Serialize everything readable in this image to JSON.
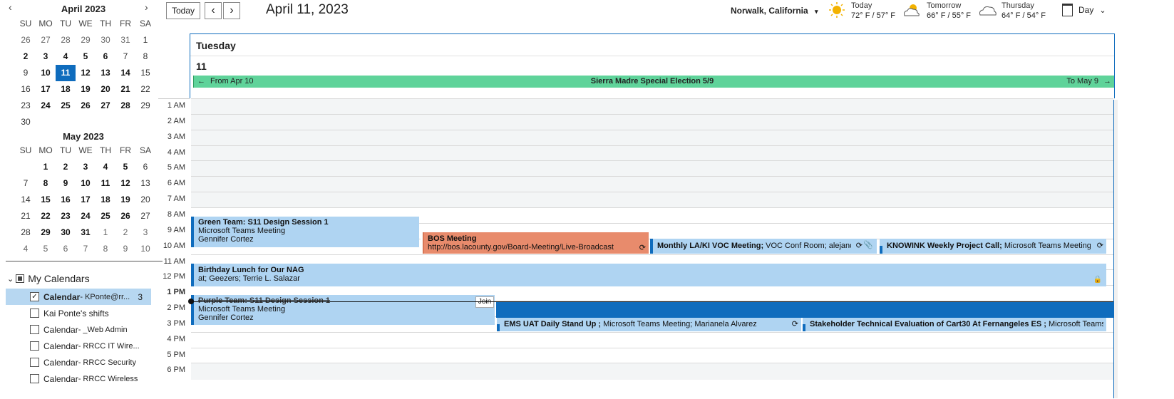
{
  "mini_calendars": [
    {
      "title": "April 2023",
      "dows": [
        "SU",
        "MO",
        "TU",
        "WE",
        "TH",
        "FR",
        "SA"
      ],
      "weeks": [
        [
          "26",
          "27",
          "28",
          "29",
          "30",
          "31",
          "1"
        ],
        [
          "2",
          "3",
          "4",
          "5",
          "6",
          "7",
          "8"
        ],
        [
          "9",
          "10",
          "11",
          "12",
          "13",
          "14",
          "15"
        ],
        [
          "16",
          "17",
          "18",
          "19",
          "20",
          "21",
          "22"
        ],
        [
          "23",
          "24",
          "25",
          "26",
          "27",
          "28",
          "29"
        ],
        [
          "30",
          "",
          "",
          "",
          "",
          "",
          ""
        ]
      ]
    },
    {
      "title": "May 2023",
      "dows": [
        "SU",
        "MO",
        "TU",
        "WE",
        "TH",
        "FR",
        "SA"
      ],
      "weeks": [
        [
          "",
          "1",
          "2",
          "3",
          "4",
          "5",
          "6"
        ],
        [
          "7",
          "8",
          "9",
          "10",
          "11",
          "12",
          "13"
        ],
        [
          "14",
          "15",
          "16",
          "17",
          "18",
          "19",
          "20"
        ],
        [
          "21",
          "22",
          "23",
          "24",
          "25",
          "26",
          "27"
        ],
        [
          "28",
          "29",
          "30",
          "31",
          "1",
          "2",
          "3"
        ],
        [
          "4",
          "5",
          "6",
          "7",
          "8",
          "9",
          "10"
        ]
      ]
    }
  ],
  "nav": {
    "prev": "‹",
    "next": "›"
  },
  "my_calendars": {
    "header": "My Calendars",
    "items": [
      {
        "label": "Calendar",
        "detail": " - KPonte@rr...",
        "count": "3",
        "checked": true,
        "selected": true
      },
      {
        "label": "Kai Ponte's shifts",
        "detail": "",
        "count": "",
        "checked": false,
        "selected": false
      },
      {
        "label": "Calendar",
        "detail": " - _Web Admin",
        "count": "",
        "checked": false,
        "selected": false
      },
      {
        "label": "Calendar",
        "detail": " - RRCC IT Wire...",
        "count": "",
        "checked": false,
        "selected": false
      },
      {
        "label": "Calendar",
        "detail": " - RRCC Security",
        "count": "",
        "checked": false,
        "selected": false
      },
      {
        "label": "Calendar",
        "detail": " - RRCC Wireless",
        "count": "",
        "checked": false,
        "selected": false
      }
    ]
  },
  "toolbar": {
    "today_label": "Today",
    "prev_label": "‹",
    "next_label": "›",
    "date_title": "April 11, 2023",
    "location": "Norwalk, California",
    "view_label": "Day"
  },
  "weather": [
    {
      "label": "Today",
      "temps": "72° F / 57° F",
      "icon": "sun-icon"
    },
    {
      "label": "Tomorrow",
      "temps": "66° F / 55° F",
      "icon": "partly-cloudy-icon"
    },
    {
      "label": "Thursday",
      "temps": "64° F / 54° F",
      "icon": "cloud-icon"
    }
  ],
  "day": {
    "name": "Tuesday",
    "number": "11",
    "allday_banner": {
      "left": "From Apr 10",
      "title": "Sierra Madre Special Election 5/9",
      "right": "To May 9",
      "color": "#5fd39a"
    }
  },
  "hours": [
    "1 AM",
    "2 AM",
    "3 AM",
    "4 AM",
    "5 AM",
    "6 AM",
    "7 AM",
    "8 AM",
    "9 AM",
    "10 AM",
    "11 AM",
    "12 PM",
    "1 PM",
    "2 PM",
    "3 PM",
    "4 PM",
    "5 PM",
    "6 PM"
  ],
  "events": {
    "green_team": {
      "title": "Green Team: S11 Design Session 1",
      "line2": "Microsoft Teams Meeting",
      "line3": "Gennifer Cortez"
    },
    "bos": {
      "title": "BOS Meeting",
      "line2": "http://bos.lacounty.gov/Board-Meeting/Live-Broadcast"
    },
    "monthly": {
      "title": "Monthly LA/KI VOC Meeting;",
      "rest": " VOC Conf Room; alejandra"
    },
    "knowink": {
      "title": "KNOWINK Weekly Project Call;",
      "rest": " Microsoft Teams Meeting; A"
    },
    "birthday": {
      "title": "Birthday Lunch for Our NAG",
      "line2": "at; Geezers; Terrie L. Salazar"
    },
    "purple": {
      "title": "Purple Team: S11 Design Session 1",
      "line2": "Microsoft Teams Meeting",
      "line3": "Gennifer Cortez",
      "join": "Join"
    },
    "ems": {
      "title": "EMS UAT Daily Stand Up ;",
      "rest": " Microsoft Teams Meeting; Marianela Alvarez"
    },
    "stakeholder": {
      "title": "Stakeholder Technical Evaluation of Cart30 At Fernangeles ES ;",
      "rest": " Microsoft Teams Mee"
    }
  },
  "colors": {
    "accent": "#0f6cbd",
    "event_blue": "#afd4f2",
    "event_orange": "#e88b6c",
    "banner_green": "#5fd39a"
  }
}
